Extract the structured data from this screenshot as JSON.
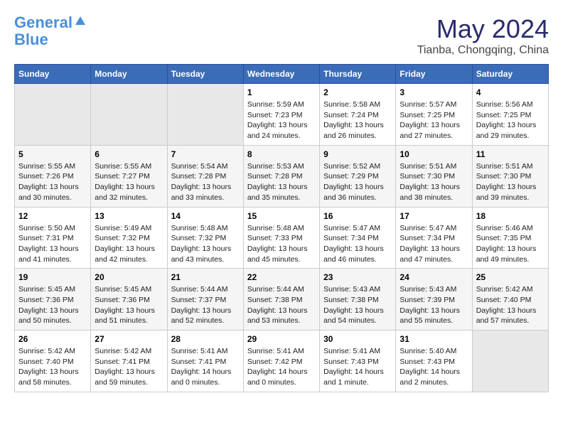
{
  "logo": {
    "line1": "General",
    "line2": "Blue"
  },
  "title": "May 2024",
  "location": "Tianba, Chongqing, China",
  "headers": [
    "Sunday",
    "Monday",
    "Tuesday",
    "Wednesday",
    "Thursday",
    "Friday",
    "Saturday"
  ],
  "weeks": [
    [
      {
        "day": "",
        "info": ""
      },
      {
        "day": "",
        "info": ""
      },
      {
        "day": "",
        "info": ""
      },
      {
        "day": "1",
        "info": "Sunrise: 5:59 AM\nSunset: 7:23 PM\nDaylight: 13 hours\nand 24 minutes."
      },
      {
        "day": "2",
        "info": "Sunrise: 5:58 AM\nSunset: 7:24 PM\nDaylight: 13 hours\nand 26 minutes."
      },
      {
        "day": "3",
        "info": "Sunrise: 5:57 AM\nSunset: 7:25 PM\nDaylight: 13 hours\nand 27 minutes."
      },
      {
        "day": "4",
        "info": "Sunrise: 5:56 AM\nSunset: 7:25 PM\nDaylight: 13 hours\nand 29 minutes."
      }
    ],
    [
      {
        "day": "5",
        "info": "Sunrise: 5:55 AM\nSunset: 7:26 PM\nDaylight: 13 hours\nand 30 minutes."
      },
      {
        "day": "6",
        "info": "Sunrise: 5:55 AM\nSunset: 7:27 PM\nDaylight: 13 hours\nand 32 minutes."
      },
      {
        "day": "7",
        "info": "Sunrise: 5:54 AM\nSunset: 7:28 PM\nDaylight: 13 hours\nand 33 minutes."
      },
      {
        "day": "8",
        "info": "Sunrise: 5:53 AM\nSunset: 7:28 PM\nDaylight: 13 hours\nand 35 minutes."
      },
      {
        "day": "9",
        "info": "Sunrise: 5:52 AM\nSunset: 7:29 PM\nDaylight: 13 hours\nand 36 minutes."
      },
      {
        "day": "10",
        "info": "Sunrise: 5:51 AM\nSunset: 7:30 PM\nDaylight: 13 hours\nand 38 minutes."
      },
      {
        "day": "11",
        "info": "Sunrise: 5:51 AM\nSunset: 7:30 PM\nDaylight: 13 hours\nand 39 minutes."
      }
    ],
    [
      {
        "day": "12",
        "info": "Sunrise: 5:50 AM\nSunset: 7:31 PM\nDaylight: 13 hours\nand 41 minutes."
      },
      {
        "day": "13",
        "info": "Sunrise: 5:49 AM\nSunset: 7:32 PM\nDaylight: 13 hours\nand 42 minutes."
      },
      {
        "day": "14",
        "info": "Sunrise: 5:48 AM\nSunset: 7:32 PM\nDaylight: 13 hours\nand 43 minutes."
      },
      {
        "day": "15",
        "info": "Sunrise: 5:48 AM\nSunset: 7:33 PM\nDaylight: 13 hours\nand 45 minutes."
      },
      {
        "day": "16",
        "info": "Sunrise: 5:47 AM\nSunset: 7:34 PM\nDaylight: 13 hours\nand 46 minutes."
      },
      {
        "day": "17",
        "info": "Sunrise: 5:47 AM\nSunset: 7:34 PM\nDaylight: 13 hours\nand 47 minutes."
      },
      {
        "day": "18",
        "info": "Sunrise: 5:46 AM\nSunset: 7:35 PM\nDaylight: 13 hours\nand 49 minutes."
      }
    ],
    [
      {
        "day": "19",
        "info": "Sunrise: 5:45 AM\nSunset: 7:36 PM\nDaylight: 13 hours\nand 50 minutes."
      },
      {
        "day": "20",
        "info": "Sunrise: 5:45 AM\nSunset: 7:36 PM\nDaylight: 13 hours\nand 51 minutes."
      },
      {
        "day": "21",
        "info": "Sunrise: 5:44 AM\nSunset: 7:37 PM\nDaylight: 13 hours\nand 52 minutes."
      },
      {
        "day": "22",
        "info": "Sunrise: 5:44 AM\nSunset: 7:38 PM\nDaylight: 13 hours\nand 53 minutes."
      },
      {
        "day": "23",
        "info": "Sunrise: 5:43 AM\nSunset: 7:38 PM\nDaylight: 13 hours\nand 54 minutes."
      },
      {
        "day": "24",
        "info": "Sunrise: 5:43 AM\nSunset: 7:39 PM\nDaylight: 13 hours\nand 55 minutes."
      },
      {
        "day": "25",
        "info": "Sunrise: 5:42 AM\nSunset: 7:40 PM\nDaylight: 13 hours\nand 57 minutes."
      }
    ],
    [
      {
        "day": "26",
        "info": "Sunrise: 5:42 AM\nSunset: 7:40 PM\nDaylight: 13 hours\nand 58 minutes."
      },
      {
        "day": "27",
        "info": "Sunrise: 5:42 AM\nSunset: 7:41 PM\nDaylight: 13 hours\nand 59 minutes."
      },
      {
        "day": "28",
        "info": "Sunrise: 5:41 AM\nSunset: 7:41 PM\nDaylight: 14 hours\nand 0 minutes."
      },
      {
        "day": "29",
        "info": "Sunrise: 5:41 AM\nSunset: 7:42 PM\nDaylight: 14 hours\nand 0 minutes."
      },
      {
        "day": "30",
        "info": "Sunrise: 5:41 AM\nSunset: 7:43 PM\nDaylight: 14 hours\nand 1 minute."
      },
      {
        "day": "31",
        "info": "Sunrise: 5:40 AM\nSunset: 7:43 PM\nDaylight: 14 hours\nand 2 minutes."
      },
      {
        "day": "",
        "info": ""
      }
    ]
  ]
}
